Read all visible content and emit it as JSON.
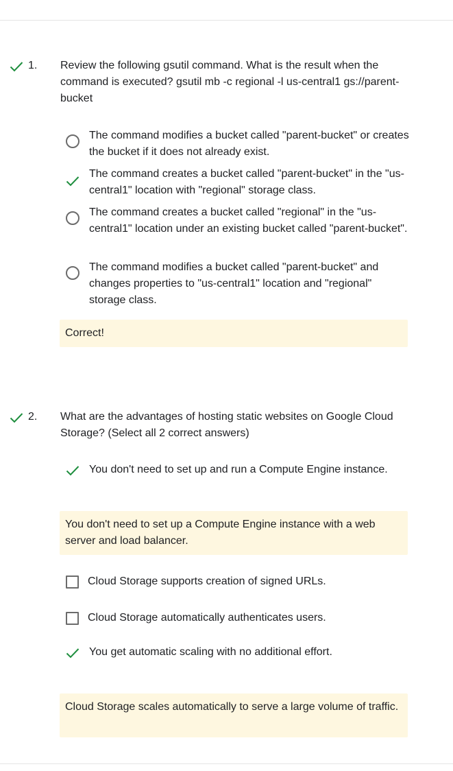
{
  "colors": {
    "correct_green": "#1e8e3e",
    "feedback_bg": "#fef7e0",
    "divider": "#e4e4e4"
  },
  "questions": [
    {
      "number": "1.",
      "status_icon": "checkmark-icon",
      "text": "Review the following gsutil command. What is the result when the command is executed? gsutil mb -c regional -l us-central1 gs://parent-bucket",
      "options": [
        {
          "label": "The command modifies a bucket called \"parent-bucket\" or creates the bucket if it does not already exist.",
          "state": "radio-unselected"
        },
        {
          "label": "The command creates a bucket called \"parent-bucket\" in the \"us-central1\" location with \"regional\" storage class.",
          "state": "correct-check"
        },
        {
          "label": "The command creates a bucket called \"regional\" in the \"us-central1\" location under an existing bucket called \"parent-bucket\".",
          "state": "radio-unselected"
        },
        {
          "label": "The command modifies a bucket called \"parent-bucket\" and changes properties to \"us-central1\" location and \"regional\" storage class.",
          "state": "radio-unselected"
        }
      ],
      "feedback": "Correct!"
    },
    {
      "number": "2.",
      "status_icon": "checkmark-icon",
      "text": "What are the advantages of hosting static websites on Google Cloud Storage? (Select all 2 correct answers)",
      "options": [
        {
          "label": "You don't need to set up and run a Compute Engine instance.",
          "state": "correct-check",
          "feedback": "You don't need to set up a Compute Engine instance with a web server and load balancer."
        },
        {
          "label": "Cloud Storage supports creation of signed URLs.",
          "state": "checkbox-unchecked"
        },
        {
          "label": "Cloud Storage automatically authenticates users.",
          "state": "checkbox-unchecked"
        },
        {
          "label": "You get automatic scaling with no additional effort.",
          "state": "correct-check",
          "feedback": "Cloud Storage scales automatically to serve a large volume of traffic."
        }
      ]
    }
  ]
}
